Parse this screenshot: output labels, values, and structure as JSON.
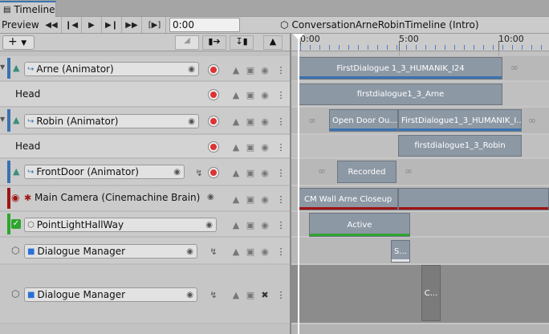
{
  "window": {
    "tab_title": "Timeline"
  },
  "toolbar": {
    "preview_label": "Preview",
    "time_value": "0:00",
    "breadcrumb": "ConversationArneRobinTimeline (Intro)"
  },
  "ruler": {
    "labels": [
      "0:00",
      "5:00",
      "10:00"
    ]
  },
  "colors": {
    "accent": "#3a72b0",
    "record": "#d33333",
    "activation": "#2ea52e",
    "camera": "#a01414"
  },
  "tracks": [
    {
      "name": "Arne (Animator)",
      "type": "animator"
    },
    {
      "name": "Head",
      "type": "sub"
    },
    {
      "name": "Robin (Animator)",
      "type": "animator"
    },
    {
      "name": "Head",
      "type": "sub"
    },
    {
      "name": "FrontDoor (Animator)",
      "type": "animator"
    },
    {
      "name": "Main Camera (Cinemachine Brain)",
      "type": "cinemachine"
    },
    {
      "name": "PointLightHallWay",
      "type": "activation"
    },
    {
      "name": "Dialogue Manager",
      "type": "signal"
    },
    {
      "name": "Dialogue Manager",
      "type": "signal"
    }
  ],
  "clips": {
    "arne": "FirstDialogue 1_3_HUMANIK_I24",
    "arne_head": "firstdialogue1_3_Arne",
    "robin_a": "Open Door Ou...",
    "robin_b": "FirstDialogue1_3_HUMANIK_I...",
    "robin_head": "firstdialogue1_3_Robin",
    "frontdoor": "Recorded",
    "camera": "CM Wall Arne Closeup",
    "light": "Active",
    "dialogue1": "S...",
    "dialogue2": "C..."
  }
}
